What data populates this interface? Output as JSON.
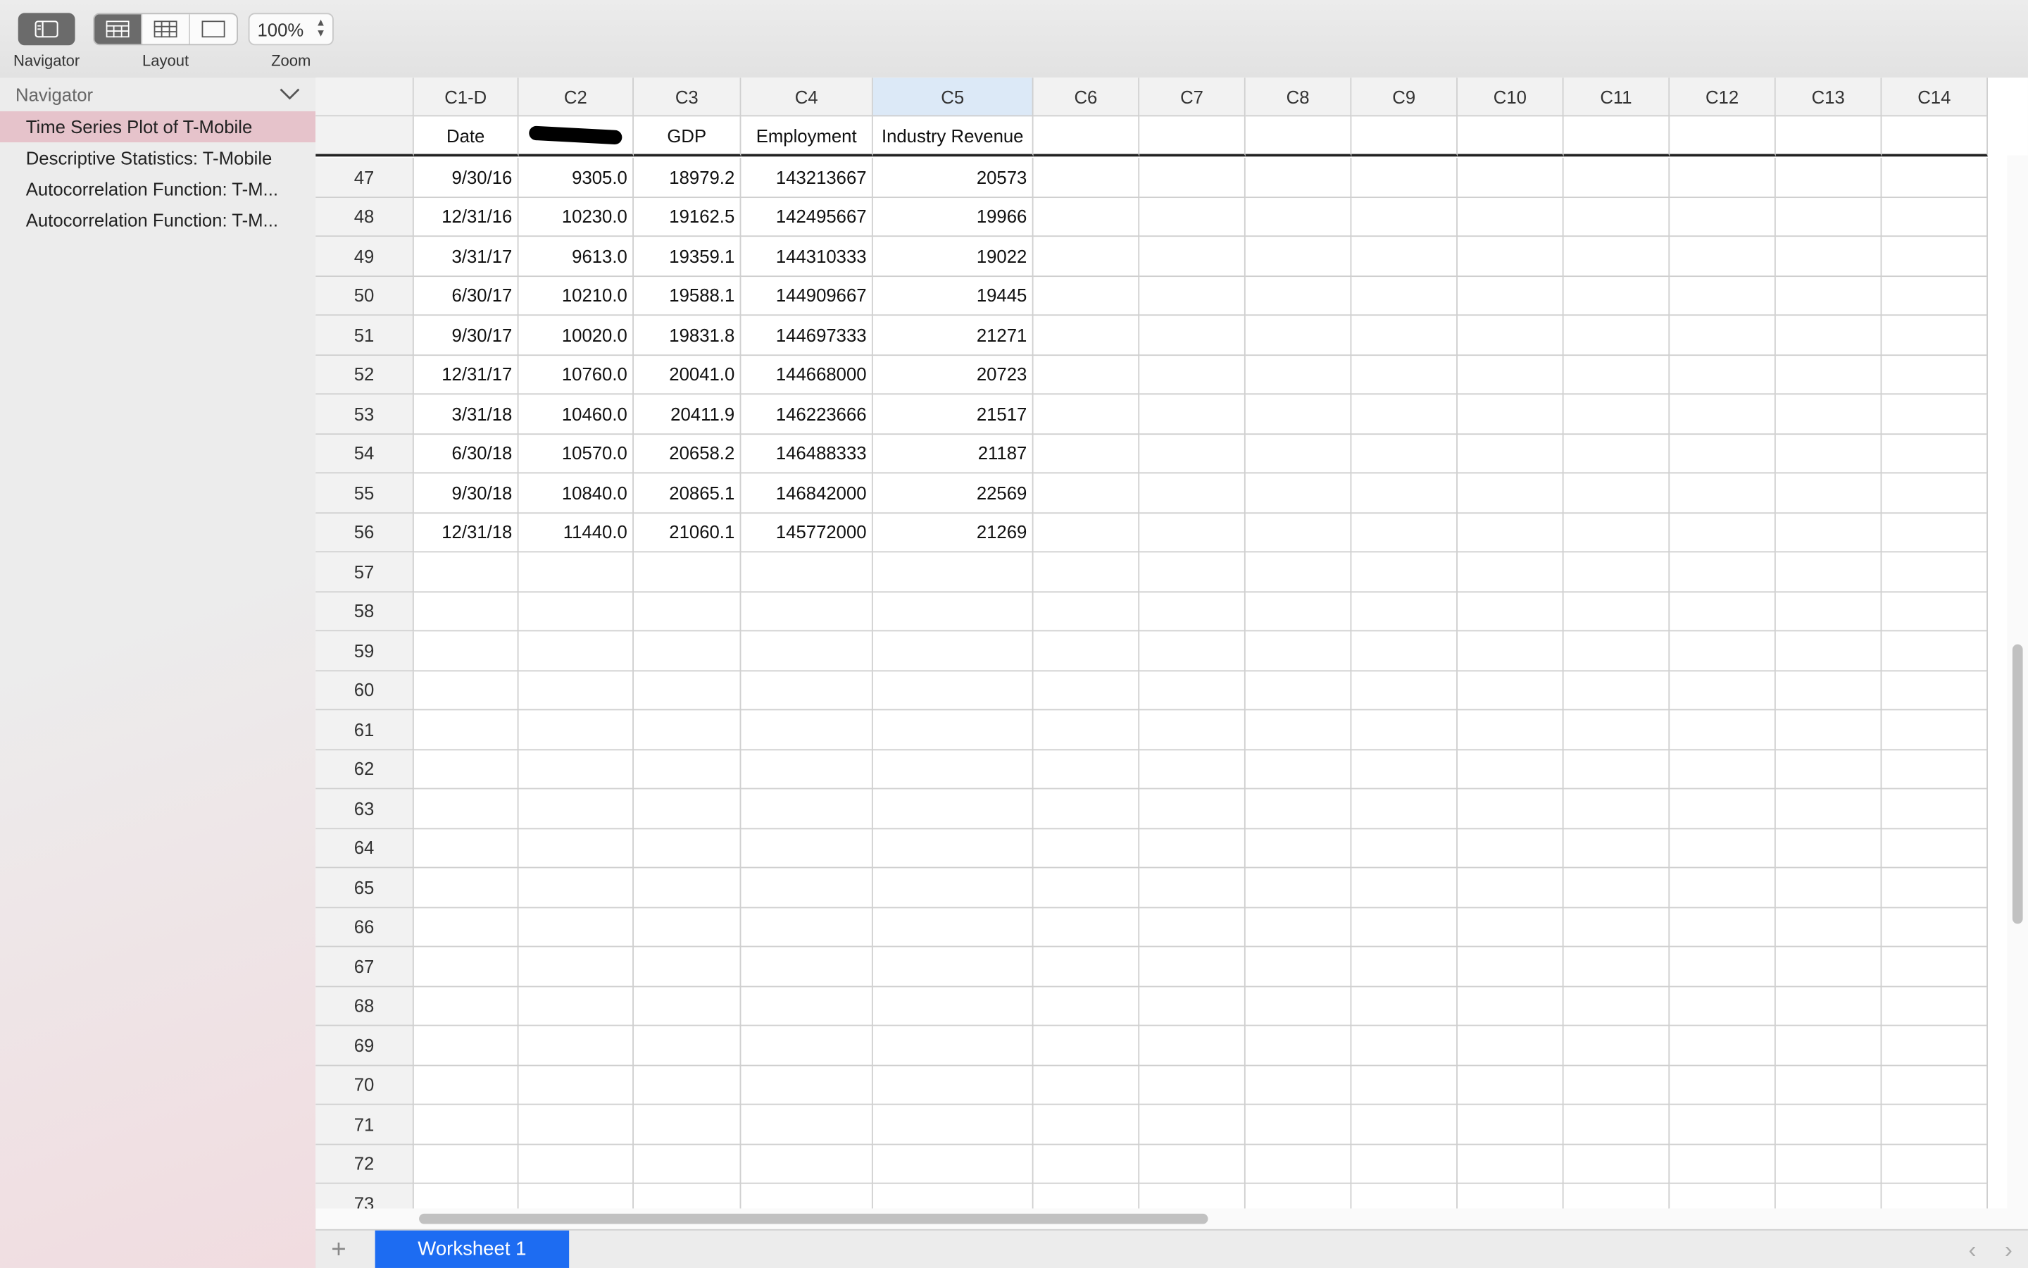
{
  "toolbar": {
    "navigator_label": "Navigator",
    "layout_label": "Layout",
    "zoom_label": "Zoom",
    "zoom_value": "100%"
  },
  "navigator": {
    "title": "Navigator",
    "items": [
      {
        "label": "Time Series Plot of T-Mobile",
        "selected": true
      },
      {
        "label": "Descriptive Statistics: T-Mobile",
        "selected": false
      },
      {
        "label": "Autocorrelation Function: T-M...",
        "selected": false
      },
      {
        "label": "Autocorrelation Function: T-M...",
        "selected": false
      }
    ]
  },
  "worksheet": {
    "columns": [
      "C1-D",
      "C2",
      "C3",
      "C4",
      "C5",
      "C6",
      "C7",
      "C8",
      "C9",
      "C10",
      "C11",
      "C12",
      "C13",
      "C14"
    ],
    "selected_column": "C5",
    "names": [
      "Date",
      "",
      "GDP",
      "Employment",
      "Industry Revenue",
      "",
      "",
      "",
      "",
      "",
      "",
      "",
      "",
      ""
    ],
    "rows": [
      {
        "n": "47",
        "cells": [
          "9/30/16",
          "9305.0",
          "18979.2",
          "143213667",
          "20573"
        ]
      },
      {
        "n": "48",
        "cells": [
          "12/31/16",
          "10230.0",
          "19162.5",
          "142495667",
          "19966"
        ]
      },
      {
        "n": "49",
        "cells": [
          "3/31/17",
          "9613.0",
          "19359.1",
          "144310333",
          "19022"
        ]
      },
      {
        "n": "50",
        "cells": [
          "6/30/17",
          "10210.0",
          "19588.1",
          "144909667",
          "19445"
        ]
      },
      {
        "n": "51",
        "cells": [
          "9/30/17",
          "10020.0",
          "19831.8",
          "144697333",
          "21271"
        ]
      },
      {
        "n": "52",
        "cells": [
          "12/31/17",
          "10760.0",
          "20041.0",
          "144668000",
          "20723"
        ]
      },
      {
        "n": "53",
        "cells": [
          "3/31/18",
          "10460.0",
          "20411.9",
          "146223666",
          "21517"
        ]
      },
      {
        "n": "54",
        "cells": [
          "6/30/18",
          "10570.0",
          "20658.2",
          "146488333",
          "21187"
        ]
      },
      {
        "n": "55",
        "cells": [
          "9/30/18",
          "10840.0",
          "20865.1",
          "146842000",
          "22569"
        ]
      },
      {
        "n": "56",
        "cells": [
          "12/31/18",
          "11440.0",
          "21060.1",
          "145772000",
          "21269"
        ]
      },
      {
        "n": "57",
        "cells": []
      },
      {
        "n": "58",
        "cells": []
      },
      {
        "n": "59",
        "cells": []
      },
      {
        "n": "60",
        "cells": []
      },
      {
        "n": "61",
        "cells": []
      },
      {
        "n": "62",
        "cells": []
      },
      {
        "n": "63",
        "cells": []
      },
      {
        "n": "64",
        "cells": []
      },
      {
        "n": "65",
        "cells": []
      },
      {
        "n": "66",
        "cells": []
      },
      {
        "n": "67",
        "cells": []
      },
      {
        "n": "68",
        "cells": []
      },
      {
        "n": "69",
        "cells": []
      },
      {
        "n": "70",
        "cells": []
      },
      {
        "n": "71",
        "cells": []
      },
      {
        "n": "72",
        "cells": []
      },
      {
        "n": "73",
        "cells": []
      }
    ]
  },
  "sheets": {
    "active_tab": "Worksheet 1",
    "add_icon": "plus-icon"
  },
  "colors": {
    "accent": "#1d6cf2",
    "nav_selected": "#e6c3cb",
    "selected_column": "#dce9f7"
  }
}
